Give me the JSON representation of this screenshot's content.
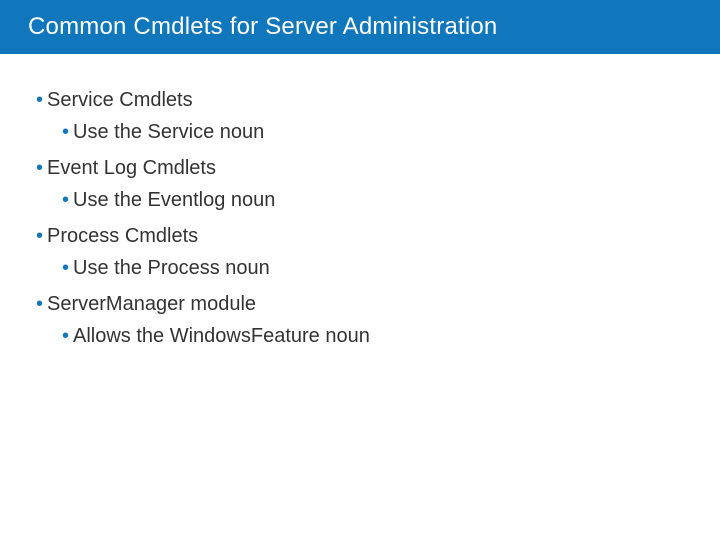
{
  "title": "Common Cmdlets for Server Administration",
  "items": [
    {
      "label": "Service Cmdlets",
      "sub": "Use the Service noun"
    },
    {
      "label": "Event Log Cmdlets",
      "sub": "Use the Eventlog noun"
    },
    {
      "label": "Process Cmdlets",
      "sub": "Use the Process noun"
    },
    {
      "label": "ServerManager module",
      "sub": "Allows the WindowsFeature noun"
    }
  ]
}
